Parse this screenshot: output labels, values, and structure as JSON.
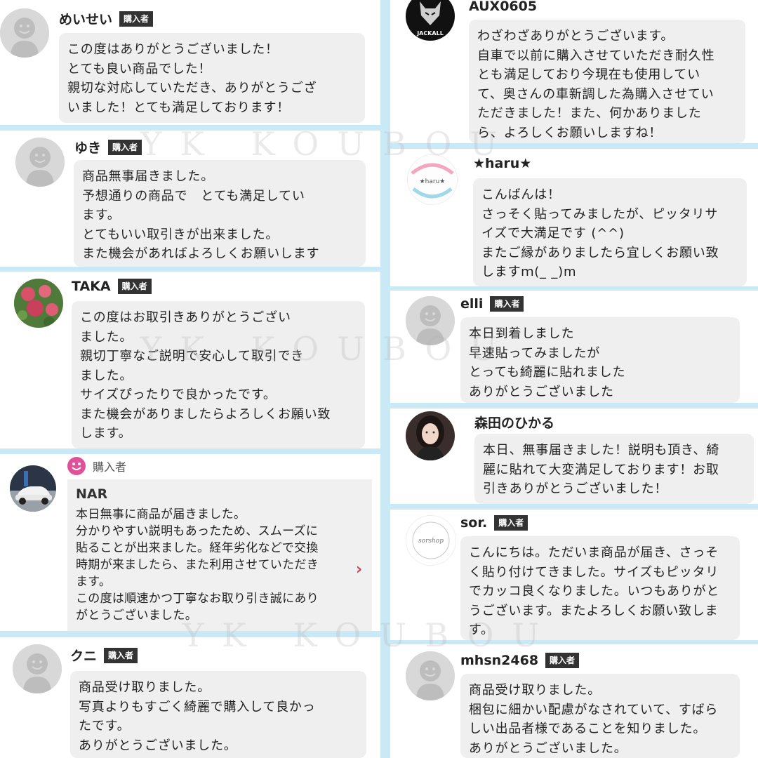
{
  "badge_label": "購入者",
  "watermark": "YK KOUBOU",
  "left": [
    {
      "name": "めいせい",
      "lines": [
        "この度はありがとうございました！",
        "とても良い商品でした！",
        "親切な対応していただき、ありがとうござ",
        "いました！とても満足しております！"
      ]
    },
    {
      "name": "ゆき",
      "lines": [
        "商品無事届きました。",
        "予想通りの商品で　とても満足してい",
        "ます。",
        "とてもいい取引きが出来ました。",
        "また機会があればよろしくお願いします"
      ]
    },
    {
      "name": "TAKA",
      "lines": [
        "この度はお取引きありがとうござい",
        "ました。",
        "親切丁寧なご説明で安心して取引でき",
        "ました。",
        "サイズぴったりで良かったです。",
        "また機会がありましたらよろしくお願い致",
        "します。"
      ]
    },
    {
      "name": "NAR",
      "header_label": "購入者",
      "lines": [
        "本日無事に商品が届きました。",
        "分かりやすい説明もあったため、スムーズに",
        "貼ることが出来ました。経年劣化などで交換",
        "時期が来ましたら、また利用させていただき",
        "ます。",
        "この度は順速かつ丁寧なお取り引き誠にあり",
        "がとうございました。"
      ]
    },
    {
      "name": "クニ",
      "lines": [
        "商品受け取りました。",
        "写真よりもすごく綺麗で購入して良かっ",
        "たです。",
        "ありがとうございました。"
      ]
    }
  ],
  "right": [
    {
      "name": "AUX0605",
      "avatar_text": "JACKALL",
      "lines": [
        "わざわざありがとうございます。",
        "自車で以前に購入させていただき耐久性",
        "とも満足しており今現在も使用してい",
        "て、奥さんの車新調した為購入させてい",
        "ただきました！また、何かありました",
        "ら、よろしくお願いしますね！"
      ]
    },
    {
      "name": "★haru★",
      "avatar_text": "★haru★",
      "lines": [
        "こんばんは！",
        "さっそく貼ってみましたが、ピッタリサ",
        "イズで大満足です (^^)",
        "またご縁がありましたら宜しくお願い致",
        "しますｍ(_ _)m"
      ]
    },
    {
      "name": "elli",
      "lines": [
        "本日到着しました",
        "早速貼ってみましたが",
        "とっても綺麗に貼れました",
        "ありがとうございました"
      ]
    },
    {
      "name": "森田のひかる",
      "lines": [
        "本日、無事届きました！説明も頂き、綺",
        "麗に貼れて大変満足しております！お取",
        "引きありがとうございました！"
      ]
    },
    {
      "name": "sor.",
      "avatar_text": "sorshop",
      "lines": [
        "こんにちは。ただいま商品が届き、さっそ",
        "く貼り付けてきました。サイズもピッタリ",
        "でカッコ良くなりました。いつもありがと",
        "うございます。またよろしくお願い致しま",
        "す。"
      ]
    },
    {
      "name": "mhsn2468",
      "lines": [
        "商品受け取りました。",
        "梱包に細かい配慮がなされていて、すばら",
        "しい出品者様であることを知りました。",
        "ありがとうございました。"
      ]
    }
  ]
}
